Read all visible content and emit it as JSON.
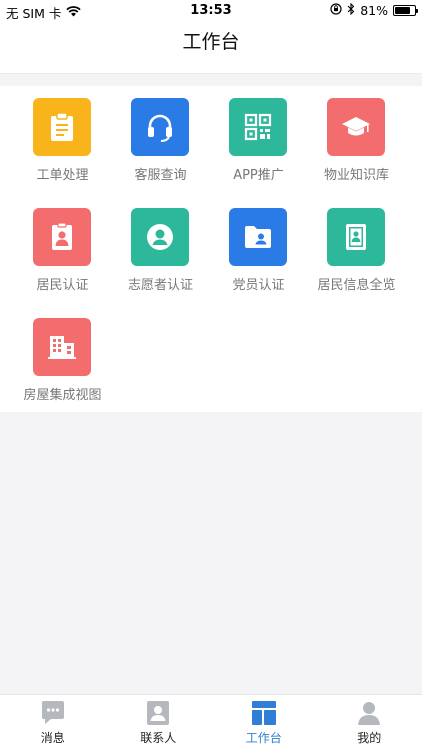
{
  "status_bar": {
    "carrier": "无 SIM 卡",
    "time": "13:53",
    "battery": "81%",
    "battery_level": 0.81
  },
  "header": {
    "title": "工作台"
  },
  "apps": [
    {
      "label": "工单处理",
      "icon": "clipboard-icon",
      "color": "#f9b41b"
    },
    {
      "label": "客服查询",
      "icon": "headset-icon",
      "color": "#2a7be6"
    },
    {
      "label": "APP推广",
      "icon": "qr-code-icon",
      "color": "#2eb89b"
    },
    {
      "label": "物业知识库",
      "icon": "graduation-cap-icon",
      "color": "#f36d6e"
    },
    {
      "label": "居民认证",
      "icon": "id-badge-icon",
      "color": "#f36d6e"
    },
    {
      "label": "志愿者认证",
      "icon": "user-circle-icon",
      "color": "#2eb89b"
    },
    {
      "label": "党员认证",
      "icon": "user-folder-icon",
      "color": "#2a7be6"
    },
    {
      "label": "居民信息全览",
      "icon": "contact-book-icon",
      "color": "#2eb89b"
    },
    {
      "label": "房屋集成视图",
      "icon": "building-icon",
      "color": "#f36d6e"
    }
  ],
  "tabs": [
    {
      "label": "消息",
      "icon": "message-icon",
      "active": false
    },
    {
      "label": "联系人",
      "icon": "contacts-icon",
      "active": false
    },
    {
      "label": "工作台",
      "icon": "dashboard-icon",
      "active": true
    },
    {
      "label": "我的",
      "icon": "profile-icon",
      "active": false
    }
  ],
  "colors": {
    "accent": "#2f7fd6",
    "tab_inactive": "#b5b8bd"
  }
}
